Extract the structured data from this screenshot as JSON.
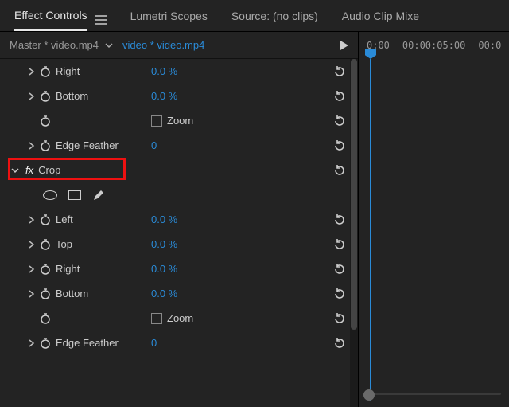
{
  "tabs": {
    "effect_controls": "Effect Controls",
    "lumetri_scopes": "Lumetri Scopes",
    "source": "Source: (no clips)",
    "audio_clip_mixer": "Audio Clip Mixe"
  },
  "header": {
    "master": "Master * video.mp4",
    "clip": "video * video.mp4"
  },
  "timecodes": {
    "t0": "0:00",
    "t1": "00:00:05:00",
    "t2": "00:0"
  },
  "group1": {
    "right_label": "Right",
    "right_value": "0.0 %",
    "bottom_label": "Bottom",
    "bottom_value": "0.0 %",
    "zoom_label": "Zoom",
    "feather_label": "Edge Feather",
    "feather_value": "0"
  },
  "crop": {
    "title": "Crop",
    "left_label": "Left",
    "left_value": "0.0 %",
    "top_label": "Top",
    "top_value": "0.0 %",
    "right_label": "Right",
    "right_value": "0.0 %",
    "bottom_label": "Bottom",
    "bottom_value": "0.0 %",
    "zoom_label": "Zoom",
    "feather_label": "Edge Feather",
    "feather_value": "0"
  }
}
